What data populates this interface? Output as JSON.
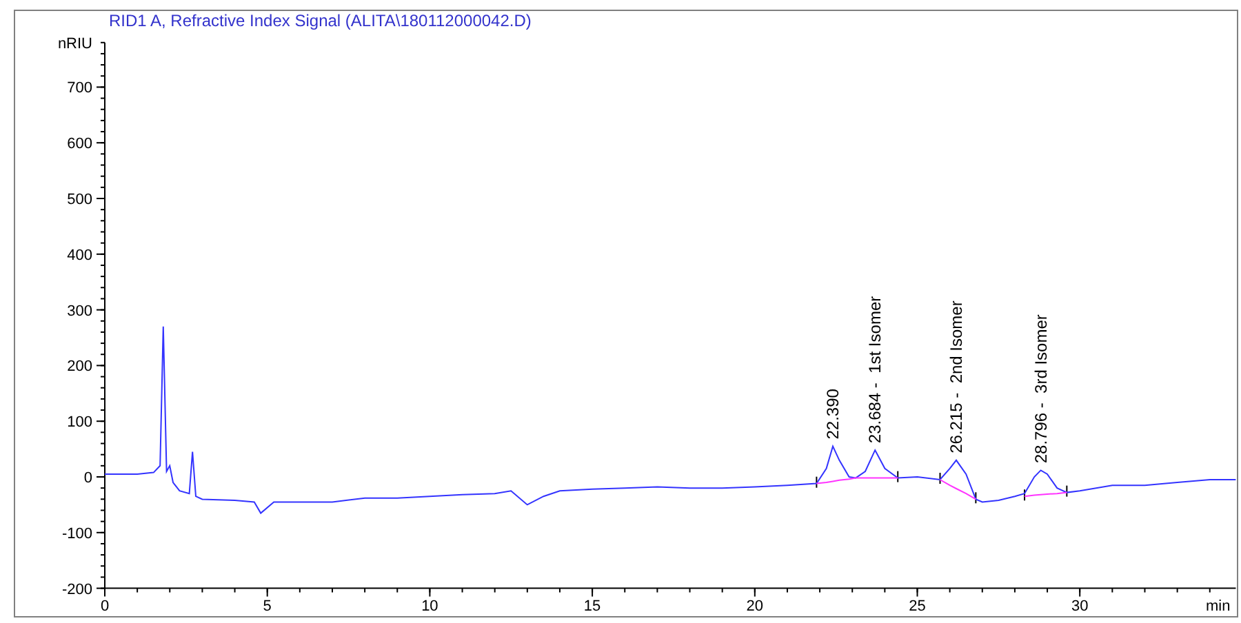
{
  "title": "RID1 A, Refractive Index Signal (ALITA\\180112000042.D)",
  "chart_data": {
    "type": "line",
    "ylabel": "nRIU",
    "xlabel": "min",
    "xlim": [
      0,
      34.8
    ],
    "ylim": [
      -200,
      780
    ],
    "xticks": [
      0,
      5,
      10,
      15,
      20,
      25,
      30
    ],
    "yticks": [
      -200,
      -100,
      0,
      100,
      200,
      300,
      400,
      500,
      600,
      700
    ],
    "x": [
      0,
      0.5,
      1,
      1.5,
      1.7,
      1.8,
      1.9,
      2.0,
      2.1,
      2.3,
      2.6,
      2.7,
      2.8,
      3,
      4,
      4.6,
      4.8,
      5.2,
      6,
      7,
      8,
      9,
      10,
      11,
      12,
      12.5,
      13,
      13.5,
      14,
      15,
      16,
      17,
      18,
      19,
      20,
      21,
      21.9,
      22.2,
      22.4,
      22.6,
      22.9,
      23.1,
      23.4,
      23.7,
      24,
      24.4,
      25,
      25.7,
      26,
      26.2,
      26.5,
      26.8,
      27,
      27.5,
      28,
      28.3,
      28.6,
      28.8,
      29,
      29.3,
      29.6,
      30,
      31,
      32,
      33,
      34,
      34.8
    ],
    "series": [
      {
        "color": "#3333ff",
        "values": [
          5,
          5,
          5,
          8,
          20,
          270,
          10,
          20,
          -10,
          -25,
          -30,
          45,
          -35,
          -40,
          -42,
          -45,
          -65,
          -45,
          -45,
          -45,
          -38,
          -38,
          -35,
          -32,
          -30,
          -25,
          -50,
          -35,
          -25,
          -22,
          -20,
          -18,
          -20,
          -20,
          -18,
          -15,
          -12,
          15,
          55,
          30,
          0,
          -2,
          10,
          48,
          15,
          -2,
          0,
          -5,
          15,
          30,
          5,
          -40,
          -45,
          -42,
          -35,
          -30,
          0,
          12,
          5,
          -20,
          -28,
          -25,
          -15,
          -15,
          -10,
          -5,
          -5
        ]
      },
      {
        "color": "#ff33ff",
        "values": [
          null,
          null,
          null,
          null,
          null,
          null,
          null,
          null,
          null,
          null,
          null,
          null,
          null,
          null,
          null,
          null,
          null,
          null,
          null,
          null,
          null,
          null,
          null,
          null,
          null,
          null,
          null,
          null,
          null,
          null,
          null,
          null,
          null,
          null,
          null,
          null,
          -12,
          -10,
          -8,
          -6,
          -4,
          -2,
          -2,
          -2,
          -2,
          -2,
          null,
          -5,
          -15,
          -21,
          -30,
          -40,
          null,
          null,
          null,
          -35,
          -33,
          -32,
          -31,
          -30,
          -28,
          null,
          null,
          null,
          null,
          null,
          null
        ]
      }
    ],
    "annotations": [
      {
        "text": "22.390",
        "x": 22.4,
        "y": 55
      },
      {
        "text": "23.684 -  1st Isomer",
        "x": 23.7,
        "y": 48
      },
      {
        "text": "26.215 -  2nd Isomer",
        "x": 26.2,
        "y": 30
      },
      {
        "text": "28.796 -  3rd Isomer",
        "x": 28.8,
        "y": 12
      }
    ]
  }
}
